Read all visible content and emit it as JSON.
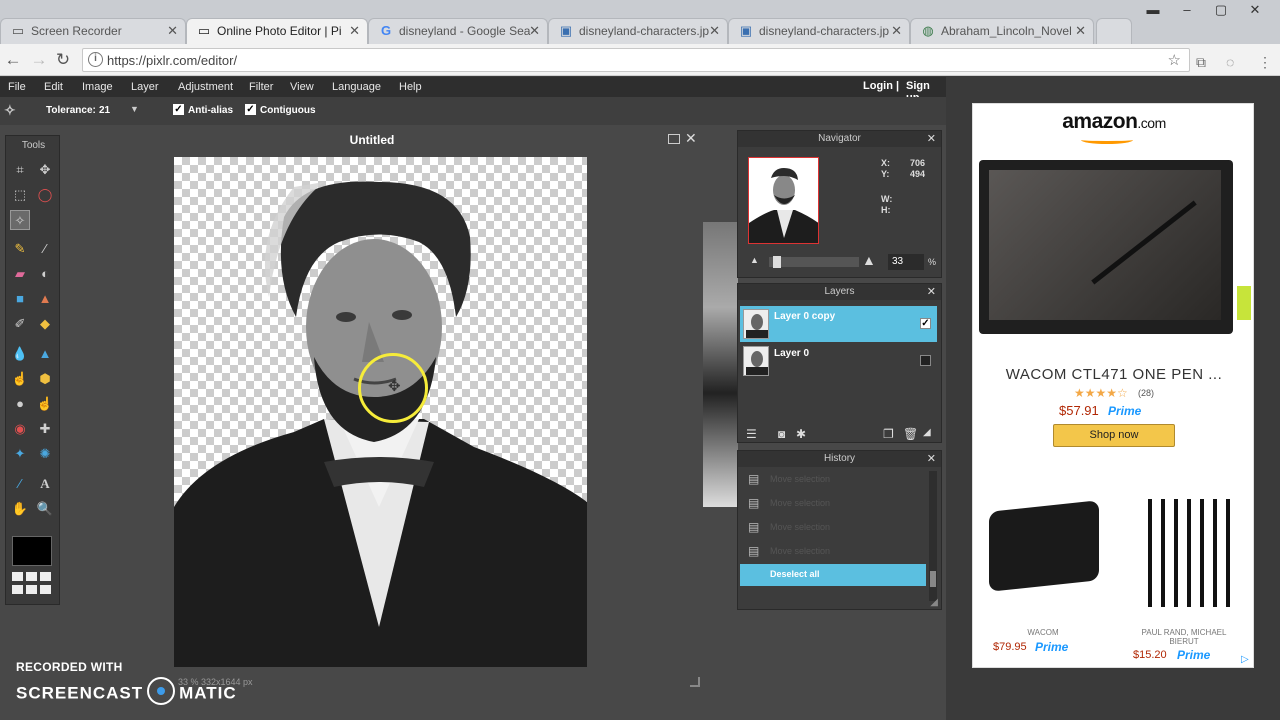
{
  "browser": {
    "tabs": [
      {
        "label": "Screen Recorder",
        "icon": "page-icon",
        "active": false
      },
      {
        "label": "Online Photo Editor | Pi",
        "icon": "page-icon",
        "active": true
      },
      {
        "label": "disneyland - Google Sea",
        "icon": "google-icon",
        "active": false
      },
      {
        "label": "disneyland-characters.jp",
        "icon": "image-icon",
        "active": false
      },
      {
        "label": "disneyland-characters.jp",
        "icon": "image-icon",
        "active": false
      },
      {
        "label": "Abraham_Lincoln_Novel",
        "icon": "globe-icon",
        "active": false
      }
    ],
    "url": "https://pixlr.com/editor/"
  },
  "menu": {
    "items": [
      "File",
      "Edit",
      "Image",
      "Layer",
      "Adjustment",
      "Filter",
      "View",
      "Language",
      "Help"
    ],
    "login": "Login",
    "separator": "|",
    "signup": "Sign up"
  },
  "options": {
    "tolerance_label": "Tolerance:",
    "tolerance_value": "21",
    "antialias_label": "Anti-alias",
    "contiguous_label": "Contiguous"
  },
  "tools": {
    "title": "Tools",
    "primary_color": "#000000"
  },
  "document": {
    "title": "Untitled",
    "status": "33 %    332x1644 px"
  },
  "navigator": {
    "title": "Navigator",
    "x_label": "X:",
    "x_value": "706",
    "y_label": "Y:",
    "y_value": "494",
    "w_label": "W:",
    "h_label": "H:",
    "zoom": "33",
    "zoom_unit": "%",
    "zoom_fraction": 0.05
  },
  "layers": {
    "title": "Layers",
    "items": [
      {
        "name": "Layer 0 copy",
        "selected": true,
        "visible": true
      },
      {
        "name": "Layer 0",
        "selected": false,
        "visible": false
      }
    ]
  },
  "history": {
    "title": "History",
    "items": [
      {
        "label": "Move selection",
        "selected": false
      },
      {
        "label": "Move selection",
        "selected": false
      },
      {
        "label": "Move selection",
        "selected": false
      },
      {
        "label": "Move selection",
        "selected": false
      },
      {
        "label": "Deselect all",
        "selected": true
      }
    ]
  },
  "ad": {
    "logo": "amazon",
    "logo_suffix": ".com",
    "product": "WACOM CTL471 ONE PEN ...",
    "reviews": "(28)",
    "price": "$57.91",
    "prime": "Prime",
    "shop_button": "Shop now",
    "sub_items": [
      {
        "brand": "WACOM",
        "price": "$79.95"
      },
      {
        "brand": "PAUL RAND, MICHAEL BIERUT",
        "price": "$15.20"
      }
    ]
  },
  "watermark": {
    "line1": "RECORDED WITH",
    "line2a": "SCREENCAST",
    "line2b": "MATIC"
  },
  "colors": {
    "accent_selected": "#5bbfe0",
    "app_background": "#484848",
    "amazon_orange": "#ff9900"
  }
}
